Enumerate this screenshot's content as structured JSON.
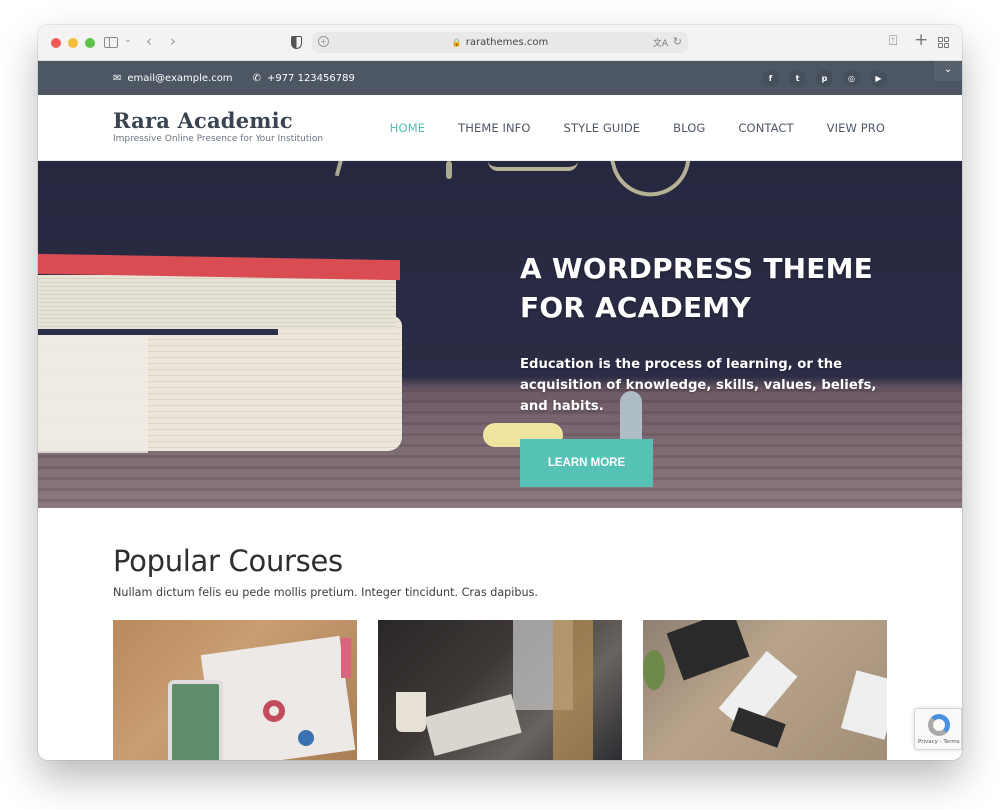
{
  "browser": {
    "url": "rarathemes.com",
    "icons": {
      "sidebar": "sidebar-icon",
      "back": "‹",
      "forward": "›",
      "new_tab": "+",
      "share": "⍐",
      "reload": "↻"
    }
  },
  "topbar": {
    "email": "email@example.com",
    "phone": "+977 123456789",
    "social": [
      {
        "name": "facebook",
        "glyph": "f"
      },
      {
        "name": "twitter",
        "glyph": "t"
      },
      {
        "name": "pinterest",
        "glyph": "p"
      },
      {
        "name": "instagram",
        "glyph": "◎"
      },
      {
        "name": "youtube",
        "glyph": "▶"
      }
    ],
    "toggle_glyph": "⌄"
  },
  "header": {
    "site_title": "Rara Academic",
    "tagline": "Impressive Online Presence for Your Institution",
    "menu": [
      {
        "label": "HOME",
        "active": true
      },
      {
        "label": "THEME INFO",
        "active": false
      },
      {
        "label": "STYLE GUIDE",
        "active": false
      },
      {
        "label": "BLOG",
        "active": false
      },
      {
        "label": "CONTACT",
        "active": false
      },
      {
        "label": "VIEW PRO",
        "active": false
      }
    ]
  },
  "hero": {
    "title_line1": "A WORDPRESS THEME",
    "title_line2": "FOR ACADEMY",
    "subtitle": "Education is the process of learning, or the acquisition of knowledge, skills, values, beliefs, and habits.",
    "button_label": "LEARN MORE"
  },
  "courses": {
    "title": "Popular Courses",
    "description": "Nullam dictum felis eu pede mollis pretium. Integer tincidunt. Cras dapibus."
  },
  "recaptcha": {
    "text": "Privacy - Terms"
  },
  "colors": {
    "accent": "#56c2b6",
    "topbar": "#4d5764",
    "heading": "#3b4452"
  }
}
